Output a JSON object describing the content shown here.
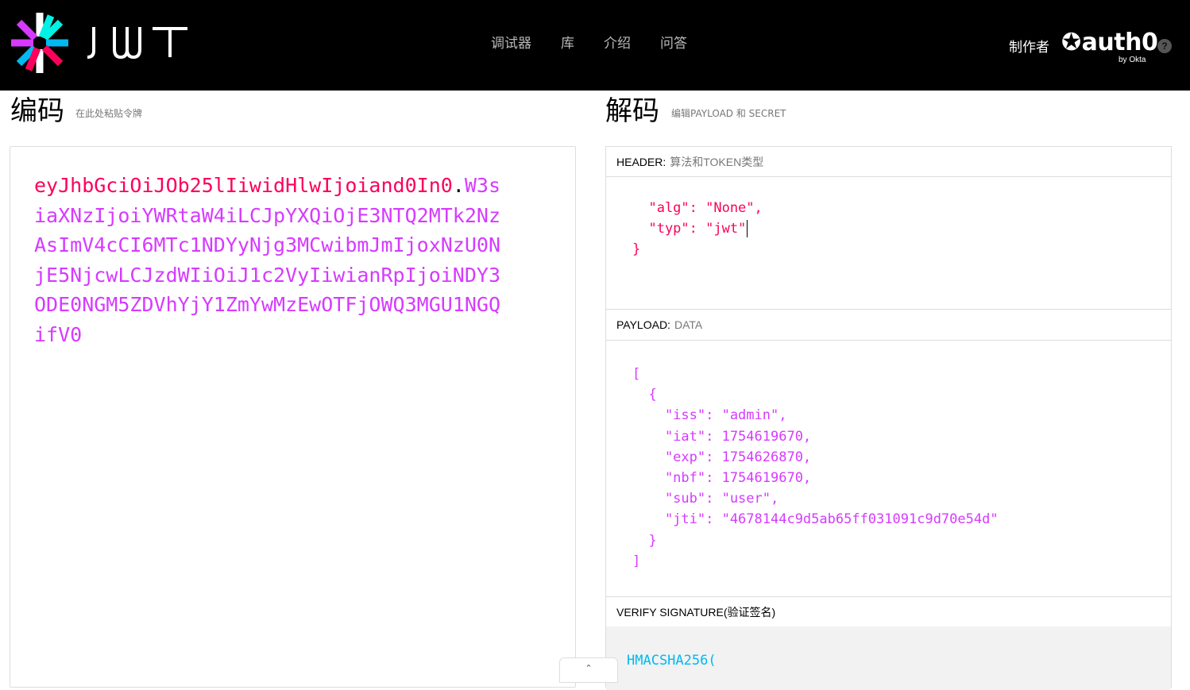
{
  "header": {
    "logo_word": "JWT",
    "nav": [
      "调试器",
      "库",
      "介绍",
      "问答"
    ],
    "made_by": "制作者",
    "brand": "auth0",
    "brand_sub": "by Okta",
    "help": "?"
  },
  "encoded": {
    "title": "编码",
    "subtitle": "在此处粘贴令牌",
    "token_header": "eyJhbGciOiJOb25lIiwidHlwIjoiand0In0",
    "token_dot": ".",
    "token_payload": "W3siaXNzIjoiYWRtaW4iLCJpYXQiOjE3NTQ2MTk2NzAsImV4cCI6MTc1NDYyNjg3MCwibmJmIjoxNzU0NjE5NjcwLCJzdWIiOiJ1c2VyIiwianRpIjoiNDY3ODE0NGM5ZDVhYjY1ZmYwMzEwOTFjOWQ3MGU1NGQifV0"
  },
  "decoded": {
    "title": "解码",
    "subtitle": "编辑PAYLOAD 和 SECRET",
    "header_label": "HEADER:",
    "header_sub": "算法和TOKEN类型",
    "header_json": "  \"alg\": \"None\",\n  \"typ\": \"jwt\"",
    "header_close": "}",
    "payload_label": "PAYLOAD:",
    "payload_sub": "DATA",
    "payload_json": "[\n  {\n    \"iss\": \"admin\",\n    \"iat\": 1754619670,\n    \"exp\": 1754626870,\n    \"nbf\": 1754619670,\n    \"sub\": \"user\",\n    \"jti\": \"4678144c9d5ab65ff031091c9d70e54d\"\n  }\n]",
    "verify_label": "VERIFY SIGNATURE(验证签名)",
    "verify_code": "HMACSHA256(",
    "collapse": "⌃"
  },
  "colors": {
    "header": "#fb015b",
    "payload": "#d63aff",
    "signature": "#00b9f1",
    "topbar": "#000000"
  }
}
